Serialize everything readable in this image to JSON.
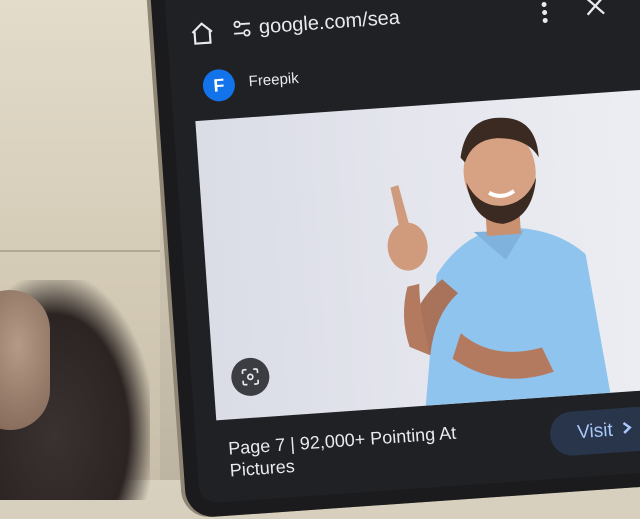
{
  "browser": {
    "url": "google.com/sea",
    "icons": [
      "home-icon",
      "tune-icon",
      "more-vert-icon",
      "close-icon"
    ]
  },
  "result": {
    "source_name": "Freepik",
    "source_logo_letter": "F",
    "caption": "Page 7 | 92,000+ Pointing At Pictures",
    "visit_label": "Visit",
    "visit_icon": "chevron-right-icon",
    "lens_icon": "google-lens-icon"
  },
  "colors": {
    "screen_bg": "#202124",
    "text": "#e8eaed",
    "accent": "#a8c7fa",
    "visit_bg": "#28354a",
    "logo_bg": "#1273eb",
    "shirt": "#8fc4ee"
  }
}
